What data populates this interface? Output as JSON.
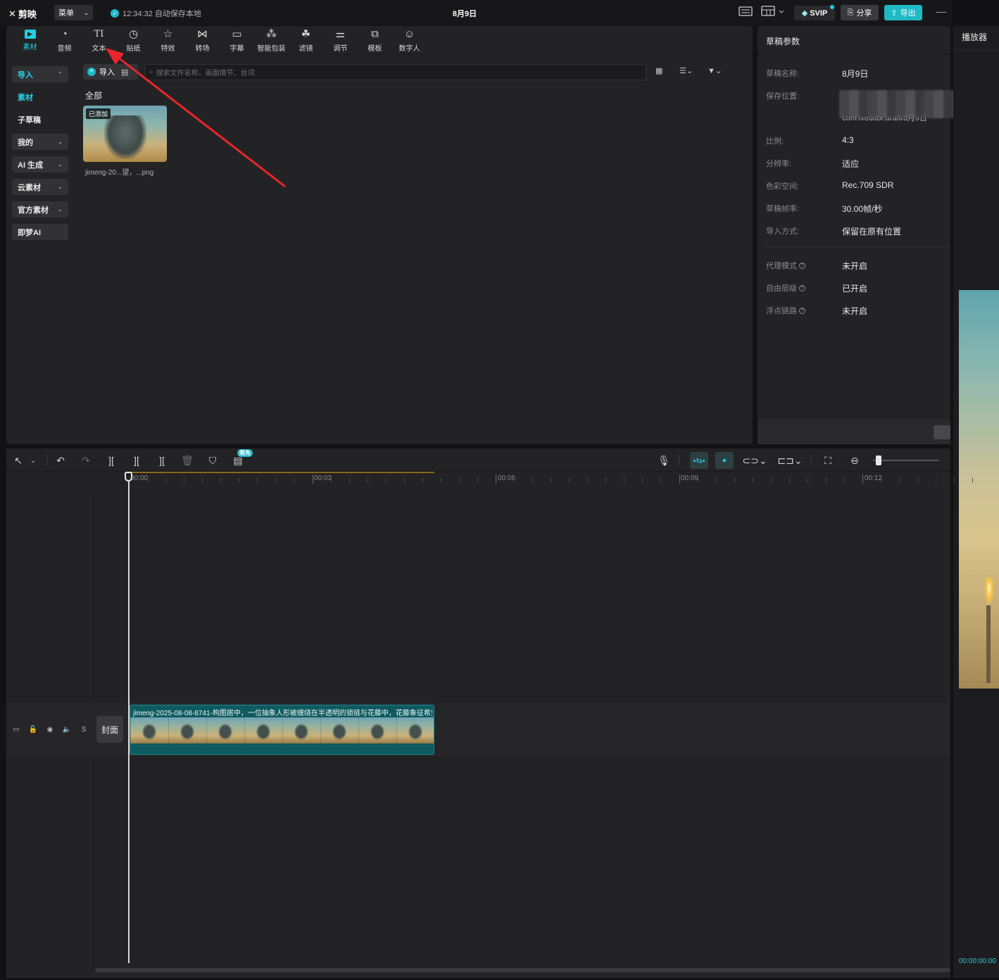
{
  "app": {
    "logo_text": "剪映",
    "menu_label": "菜单",
    "autosave_text": "12:34:32 自动保存本地",
    "document_title": "8月9日",
    "svip_label": "SVIP",
    "share_label": "分享",
    "export_label": "导出"
  },
  "tool_tabs": [
    {
      "label": "素材",
      "icon": "media-icon",
      "active": true
    },
    {
      "label": "音频",
      "icon": "audio-icon"
    },
    {
      "label": "文本",
      "icon": "text-icon"
    },
    {
      "label": "贴纸",
      "icon": "sticker-icon"
    },
    {
      "label": "特效",
      "icon": "effects-icon"
    },
    {
      "label": "转场",
      "icon": "transition-icon"
    },
    {
      "label": "字幕",
      "icon": "subtitle-icon"
    },
    {
      "label": "智能包装",
      "icon": "smart-package-icon"
    },
    {
      "label": "滤镜",
      "icon": "filter-icon"
    },
    {
      "label": "调节",
      "icon": "adjust-icon"
    },
    {
      "label": "模板",
      "icon": "template-icon"
    },
    {
      "label": "数字人",
      "icon": "digital-human-icon"
    }
  ],
  "sidebar": {
    "items": [
      {
        "label": "导入",
        "active": true,
        "expandable": true
      },
      {
        "label": "素材",
        "active": true,
        "expandable": false
      },
      {
        "label": "子草稿",
        "expandable": false
      },
      {
        "label": "我的",
        "expandable": true
      },
      {
        "label": "AI 生成",
        "expandable": true
      },
      {
        "label": "云素材",
        "expandable": true
      },
      {
        "label": "官方素材",
        "expandable": true
      },
      {
        "label": "即梦AI",
        "expandable": false
      }
    ]
  },
  "media": {
    "import_label": "导入",
    "search_placeholder": "搜索文件名称、画面情节、台词",
    "section_label": "全部",
    "items": [
      {
        "name": "jimeng-20...望，...png",
        "badge": "已添加"
      }
    ]
  },
  "properties": {
    "title": "草稿参数",
    "rows": [
      {
        "label": "草稿名称:",
        "value": "8月9日"
      },
      {
        "label": "保存位置:",
        "value": "com.lveditor.draft/8月9日"
      },
      {
        "label": "比例:",
        "value": "4:3"
      },
      {
        "label": "分辨率:",
        "value": "适应"
      },
      {
        "label": "色彩空间:",
        "value": "Rec.709 SDR"
      },
      {
        "label": "草稿帧率:",
        "value": "30.00帧/秒"
      },
      {
        "label": "导入方式:",
        "value": "保留在原有位置"
      }
    ],
    "advanced_rows": [
      {
        "label": "代理模式",
        "value": "未开启"
      },
      {
        "label": "自由层级",
        "value": "已开启"
      },
      {
        "label": "浮点链路",
        "value": "未开启"
      }
    ]
  },
  "player": {
    "title": "播放器",
    "timecode": "00:00:00:00"
  },
  "timeline": {
    "free_badge": "限免",
    "ruler_labels": [
      "00:00",
      "00:03",
      "00:06",
      "00:09",
      "00:12"
    ],
    "cover_label": "封面",
    "clip_title": "jimeng-2025-08-08-8741-构图居中，一位抽象人形被缠绕在半透明的锁链与花藤中，花藤象征希望",
    "track_controls": [
      "track-lock",
      "track-eye",
      "track-audio",
      "S"
    ]
  }
}
